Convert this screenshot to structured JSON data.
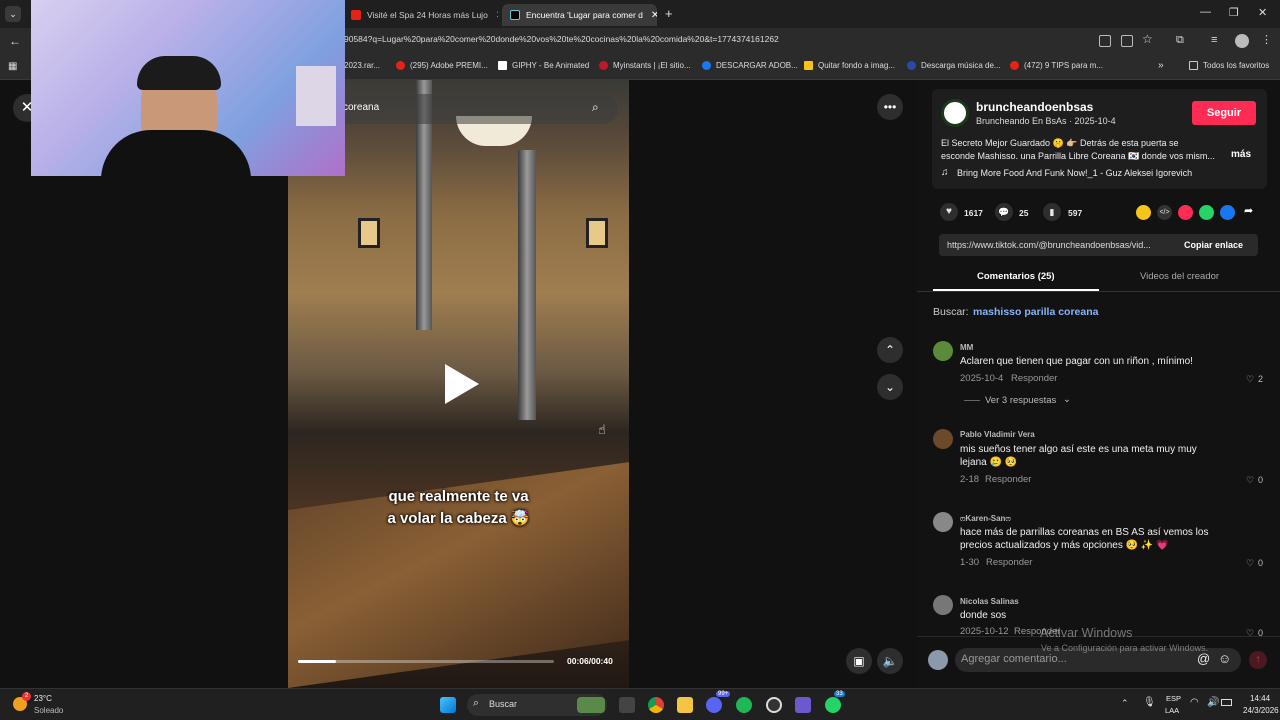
{
  "browser": {
    "tabs": [
      {
        "label": "Visité el Spa 24 Horas más Lujo"
      },
      {
        "label": "Encuentra 'Lugar para comer d"
      }
    ],
    "url": "90584?q=Lugar%20para%20comer%20donde%20vos%20te%20cocinas%20la%20comida%20&t=1774374161262",
    "bookmarks": [
      {
        "label": "2023.rar..."
      },
      {
        "label": "(295) Adobe PREMI..."
      },
      {
        "label": "GIPHY - Be Animated"
      },
      {
        "label": "Myinstants | ¡El sitio..."
      },
      {
        "label": "DESCARGAR ADOB..."
      },
      {
        "label": "Quitar fondo a imag..."
      },
      {
        "label": "Descarga música de..."
      },
      {
        "label": "(472) 9 TIPS para m..."
      }
    ],
    "bookmarks_all": "Todos los favoritos"
  },
  "video": {
    "search_text": "coreana",
    "caption_line1": "que realmente te va",
    "caption_line2": "a volar la cabeza 🤯",
    "time": "00:06/00:40",
    "progress": 0.15
  },
  "post": {
    "username": "bruncheandoenbsas",
    "subtitle": "Bruncheando En BsAs · 2025-10-4",
    "follow_label": "Seguir",
    "description_line1": "El Secreto Mejor Guardado 🤫 👉🏼 Detrás de esta puerta se",
    "description_line2": "esconde Mashisso. una Parrilla Libre Coreana 🇰🇷 donde vos mism...",
    "more_label": "más",
    "music": "Bring More Food And Funk Now!_1 - Guz Aleksei Igorevich",
    "likes": "1617",
    "comments": "25",
    "saves": "597",
    "share_link": "https://www.tiktok.com/@bruncheandoenbsas/vid...",
    "copy_label": "Copiar enlace",
    "tab_comments": "Comentarios (25)",
    "tab_creator": "Videos del creador",
    "search_prefix": "Buscar:",
    "search_term": "mashisso parilla coreana"
  },
  "comments": [
    {
      "name": "MM",
      "text": "Aclaren que tienen que pagar con un riñon , mínimo!",
      "date": "2025-10-4",
      "reply": "Responder",
      "likes": "2",
      "replies": "Ver 3 respuestas"
    },
    {
      "name": "Pablo Vladimir Vera",
      "text1": "mis sueños tener algo así este es una meta muy muy",
      "text2": "lejana 🥲 🥺",
      "date": "2-18",
      "reply": "Responder",
      "likes": "0"
    },
    {
      "name": "ෆKaren-Sanෆ",
      "text1": "hace más de parrillas coreanas en BS AS así vemos los",
      "text2": "precios actualizados y más opciones 🥺 ✨ 💗",
      "date": "1-30",
      "reply": "Responder",
      "likes": "0"
    },
    {
      "name": "Nicolas Salinas",
      "text": "donde sos",
      "date": "2025-10-12",
      "reply": "Responder",
      "likes": "0"
    }
  ],
  "comment_input_placeholder": "Agregar comentario...",
  "watermark": {
    "line1": "Activar Windows",
    "line2": "Ve a Configuración para activar Windows."
  },
  "taskbar": {
    "temp": "23°C",
    "weather": "Soleado",
    "search": "Buscar",
    "lang1": "ESP",
    "lang2": "LAA",
    "time": "14:44",
    "date": "24/3/2026",
    "weather_badge": "2",
    "discord_badge": "99+",
    "whatsapp_badge": "33"
  }
}
